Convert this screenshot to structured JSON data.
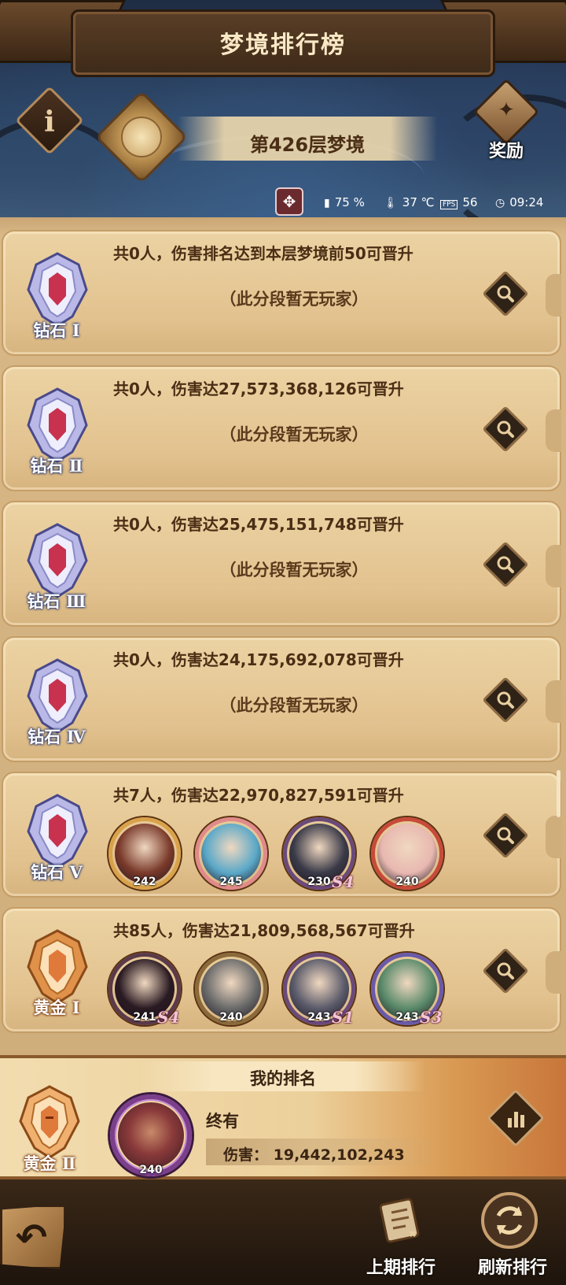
{
  "header": {
    "title": "梦境排行榜",
    "info_glyph": "i",
    "floor_label": "第426层梦境",
    "reward_label": "奖励"
  },
  "status_bar": {
    "battery": "75 %",
    "temperature": "37 ℃",
    "fps_label": "FPS",
    "fps": "56",
    "time": "09:24"
  },
  "tiers": [
    {
      "rank": "钻石 Ⅰ",
      "summary": "共0人，伤害排名达到本层梦境前50可晋升",
      "empty_text": "（此分段暂无玩家）",
      "tier_color": "diamond"
    },
    {
      "rank": "钻石 Ⅱ",
      "summary": "共0人，伤害达27,573,368,126可晋升",
      "empty_text": "（此分段暂无玩家）",
      "tier_color": "diamond"
    },
    {
      "rank": "钻石 Ⅲ",
      "summary": "共0人，伤害达25,475,151,748可晋升",
      "empty_text": "（此分段暂无玩家）",
      "tier_color": "diamond"
    },
    {
      "rank": "钻石 Ⅳ",
      "summary": "共0人，伤害达24,175,692,078可晋升",
      "empty_text": "（此分段暂无玩家）",
      "tier_color": "diamond"
    },
    {
      "rank": "钻石 Ⅴ",
      "summary": "共7人，伤害达22,970,827,591可晋升",
      "players": [
        {
          "level": "242",
          "star": "",
          "ring": "#d9a24a",
          "face": "#7a3a2a"
        },
        {
          "level": "245",
          "star": "",
          "ring": "#e08a8a",
          "face": "#5aa8c8"
        },
        {
          "level": "230",
          "star": "S4",
          "ring": "#6a4a7a",
          "face": "#3a3a48"
        },
        {
          "level": "240",
          "star": "",
          "ring": "#c84a3a",
          "face": "#e8b8b0"
        }
      ]
    },
    {
      "rank": "黄金 Ⅰ",
      "summary": "共85人，伤害达21,809,568,567可晋升",
      "players": [
        {
          "level": "241",
          "star": "S4",
          "ring": "#5a3a4a",
          "face": "#2a1a22"
        },
        {
          "level": "240",
          "star": "",
          "ring": "#8a6a3a",
          "face": "#6a6a6a"
        },
        {
          "level": "243",
          "star": "S1",
          "ring": "#6a4a7a",
          "face": "#5a5a6a"
        },
        {
          "level": "243",
          "star": "S3",
          "ring": "#6a5aaa",
          "face": "#5a8a6a"
        }
      ]
    }
  ],
  "my_rank": {
    "title": "我的排名",
    "rank": "黄金 Ⅱ",
    "name": "终有",
    "level": "240",
    "damage_label": "伤害：",
    "damage_value": "19,442,102,243"
  },
  "bottom": {
    "back_glyph": "↶",
    "last_period_label": "上期排行",
    "refresh_label": "刷新排行"
  },
  "colors": {
    "diamond_badge": "#b9b8e6",
    "diamond_gem": "#c8324e",
    "gold_badge": "#e0924a",
    "panel": "#e2c28f"
  }
}
